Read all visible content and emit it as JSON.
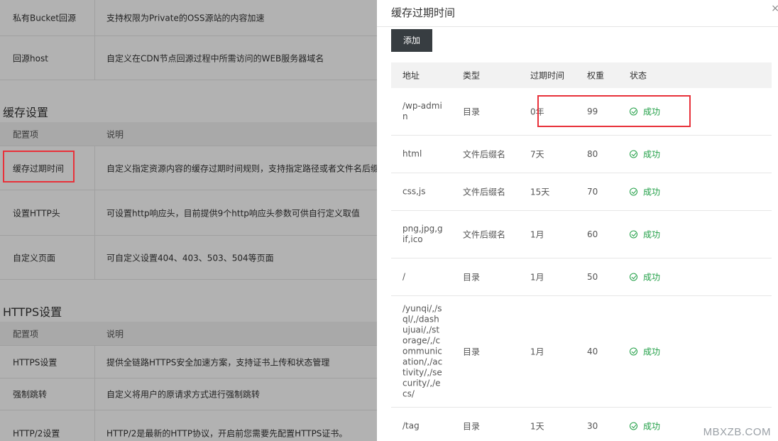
{
  "background": {
    "top_rows": [
      {
        "name": "私有Bucket回源",
        "desc": "支持权限为Private的OSS源站的内容加速"
      },
      {
        "name": "回源host",
        "desc": "自定义在CDN节点回源过程中所需访问的WEB服务器域名"
      }
    ],
    "cache_section": {
      "title": "缓存设置",
      "header": {
        "col1": "配置项",
        "col2": "说明"
      },
      "rows": [
        {
          "name": "缓存过期时间",
          "desc": "自定义指定资源内容的缓存过期时间规则，支持指定路径或者文件名后缀"
        },
        {
          "name": "设置HTTP头",
          "desc": "可设置http响应头，目前提供9个http响应头参数可供自行定义取值"
        },
        {
          "name": "自定义页面",
          "desc": "可自定义设置404、403、503、504等页面"
        }
      ]
    },
    "https_section": {
      "title": "HTTPS设置",
      "header": {
        "col1": "配置项",
        "col2": "说明"
      },
      "rows": [
        {
          "name": "HTTPS设置",
          "desc": "提供全链路HTTPS安全加速方案，支持证书上传和状态管理"
        },
        {
          "name": "强制跳转",
          "desc": "自定义将用户的原请求方式进行强制跳转"
        },
        {
          "name": "HTTP/2设置",
          "desc": "HTTP/2是最新的HTTP协议，开启前您需要先配置HTTPS证书。"
        }
      ]
    }
  },
  "panel": {
    "title": "缓存过期时间",
    "close_glyph": "×",
    "add_label": "添加",
    "columns": {
      "path": "地址",
      "type": "类型",
      "expire": "过期时间",
      "weight": "权重",
      "status": "状态"
    },
    "rows": [
      {
        "path": "/wp-admin",
        "type": "目录",
        "expire": "0年",
        "weight": "99",
        "status": "成功"
      },
      {
        "path": "html",
        "type": "文件后缀名",
        "expire": "7天",
        "weight": "80",
        "status": "成功"
      },
      {
        "path": "css,js",
        "type": "文件后缀名",
        "expire": "15天",
        "weight": "70",
        "status": "成功"
      },
      {
        "path": "png,jpg,gif,ico",
        "type": "文件后缀名",
        "expire": "1月",
        "weight": "60",
        "status": "成功"
      },
      {
        "path": "/",
        "type": "目录",
        "expire": "1月",
        "weight": "50",
        "status": "成功"
      },
      {
        "path": "/yunqi/,/sql/,/dashujuai/,/storage/,/communication/,/activity/,/security/,/ecs/",
        "type": "目录",
        "expire": "1月",
        "weight": "40",
        "status": "成功"
      },
      {
        "path": "/tag",
        "type": "目录",
        "expire": "1天",
        "weight": "30",
        "status": "成功"
      }
    ]
  },
  "watermark": "MBXZB.COM",
  "colors": {
    "accent_red": "#e8313a",
    "success_green": "#1e9e44",
    "button_dark": "#373d41"
  }
}
